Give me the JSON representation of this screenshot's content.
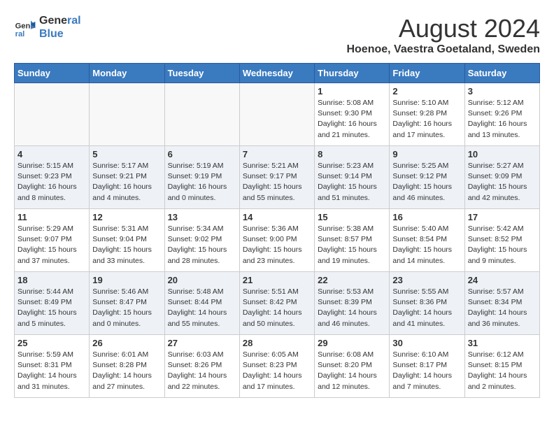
{
  "header": {
    "logo_line1": "General",
    "logo_line2": "Blue",
    "title": "August 2024",
    "location": "Hoenoe, Vaestra Goetaland, Sweden"
  },
  "weekdays": [
    "Sunday",
    "Monday",
    "Tuesday",
    "Wednesday",
    "Thursday",
    "Friday",
    "Saturday"
  ],
  "weeks": [
    [
      {
        "day": "",
        "info": ""
      },
      {
        "day": "",
        "info": ""
      },
      {
        "day": "",
        "info": ""
      },
      {
        "day": "",
        "info": ""
      },
      {
        "day": "1",
        "info": "Sunrise: 5:08 AM\nSunset: 9:30 PM\nDaylight: 16 hours\nand 21 minutes."
      },
      {
        "day": "2",
        "info": "Sunrise: 5:10 AM\nSunset: 9:28 PM\nDaylight: 16 hours\nand 17 minutes."
      },
      {
        "day": "3",
        "info": "Sunrise: 5:12 AM\nSunset: 9:26 PM\nDaylight: 16 hours\nand 13 minutes."
      }
    ],
    [
      {
        "day": "4",
        "info": "Sunrise: 5:15 AM\nSunset: 9:23 PM\nDaylight: 16 hours\nand 8 minutes."
      },
      {
        "day": "5",
        "info": "Sunrise: 5:17 AM\nSunset: 9:21 PM\nDaylight: 16 hours\nand 4 minutes."
      },
      {
        "day": "6",
        "info": "Sunrise: 5:19 AM\nSunset: 9:19 PM\nDaylight: 16 hours\nand 0 minutes."
      },
      {
        "day": "7",
        "info": "Sunrise: 5:21 AM\nSunset: 9:17 PM\nDaylight: 15 hours\nand 55 minutes."
      },
      {
        "day": "8",
        "info": "Sunrise: 5:23 AM\nSunset: 9:14 PM\nDaylight: 15 hours\nand 51 minutes."
      },
      {
        "day": "9",
        "info": "Sunrise: 5:25 AM\nSunset: 9:12 PM\nDaylight: 15 hours\nand 46 minutes."
      },
      {
        "day": "10",
        "info": "Sunrise: 5:27 AM\nSunset: 9:09 PM\nDaylight: 15 hours\nand 42 minutes."
      }
    ],
    [
      {
        "day": "11",
        "info": "Sunrise: 5:29 AM\nSunset: 9:07 PM\nDaylight: 15 hours\nand 37 minutes."
      },
      {
        "day": "12",
        "info": "Sunrise: 5:31 AM\nSunset: 9:04 PM\nDaylight: 15 hours\nand 33 minutes."
      },
      {
        "day": "13",
        "info": "Sunrise: 5:34 AM\nSunset: 9:02 PM\nDaylight: 15 hours\nand 28 minutes."
      },
      {
        "day": "14",
        "info": "Sunrise: 5:36 AM\nSunset: 9:00 PM\nDaylight: 15 hours\nand 23 minutes."
      },
      {
        "day": "15",
        "info": "Sunrise: 5:38 AM\nSunset: 8:57 PM\nDaylight: 15 hours\nand 19 minutes."
      },
      {
        "day": "16",
        "info": "Sunrise: 5:40 AM\nSunset: 8:54 PM\nDaylight: 15 hours\nand 14 minutes."
      },
      {
        "day": "17",
        "info": "Sunrise: 5:42 AM\nSunset: 8:52 PM\nDaylight: 15 hours\nand 9 minutes."
      }
    ],
    [
      {
        "day": "18",
        "info": "Sunrise: 5:44 AM\nSunset: 8:49 PM\nDaylight: 15 hours\nand 5 minutes."
      },
      {
        "day": "19",
        "info": "Sunrise: 5:46 AM\nSunset: 8:47 PM\nDaylight: 15 hours\nand 0 minutes."
      },
      {
        "day": "20",
        "info": "Sunrise: 5:48 AM\nSunset: 8:44 PM\nDaylight: 14 hours\nand 55 minutes."
      },
      {
        "day": "21",
        "info": "Sunrise: 5:51 AM\nSunset: 8:42 PM\nDaylight: 14 hours\nand 50 minutes."
      },
      {
        "day": "22",
        "info": "Sunrise: 5:53 AM\nSunset: 8:39 PM\nDaylight: 14 hours\nand 46 minutes."
      },
      {
        "day": "23",
        "info": "Sunrise: 5:55 AM\nSunset: 8:36 PM\nDaylight: 14 hours\nand 41 minutes."
      },
      {
        "day": "24",
        "info": "Sunrise: 5:57 AM\nSunset: 8:34 PM\nDaylight: 14 hours\nand 36 minutes."
      }
    ],
    [
      {
        "day": "25",
        "info": "Sunrise: 5:59 AM\nSunset: 8:31 PM\nDaylight: 14 hours\nand 31 minutes."
      },
      {
        "day": "26",
        "info": "Sunrise: 6:01 AM\nSunset: 8:28 PM\nDaylight: 14 hours\nand 27 minutes."
      },
      {
        "day": "27",
        "info": "Sunrise: 6:03 AM\nSunset: 8:26 PM\nDaylight: 14 hours\nand 22 minutes."
      },
      {
        "day": "28",
        "info": "Sunrise: 6:05 AM\nSunset: 8:23 PM\nDaylight: 14 hours\nand 17 minutes."
      },
      {
        "day": "29",
        "info": "Sunrise: 6:08 AM\nSunset: 8:20 PM\nDaylight: 14 hours\nand 12 minutes."
      },
      {
        "day": "30",
        "info": "Sunrise: 6:10 AM\nSunset: 8:17 PM\nDaylight: 14 hours\nand 7 minutes."
      },
      {
        "day": "31",
        "info": "Sunrise: 6:12 AM\nSunset: 8:15 PM\nDaylight: 14 hours\nand 2 minutes."
      }
    ]
  ]
}
